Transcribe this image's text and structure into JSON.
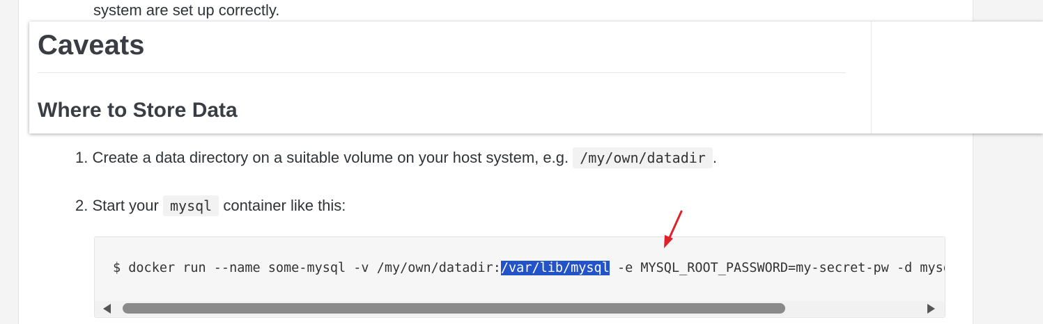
{
  "content": {
    "top_text": "system are set up correctly.",
    "heading_caveats": "Caveats",
    "heading_where": "Where to Store Data",
    "step1": {
      "number": "1.",
      "text_before": "Create a data directory on a suitable volume on your host system, e.g.",
      "code": "/my/own/datadir",
      "text_after": "."
    },
    "step2": {
      "number": "2.",
      "text_before": "Start your",
      "code": "mysql",
      "text_after": "container like this:"
    },
    "code_block": {
      "prefix": "$ docker run --name some-mysql -v /my/own/datadir:",
      "highlighted": "/var/lib/mysql",
      "suffix": " -e MYSQL_ROOT_PASSWORD=my-secret-pw -d mysql:tag"
    }
  },
  "colors": {
    "highlight": "#2353c8",
    "arrow": "#e0202a"
  },
  "icons": {
    "scroll_left": "triangle-left",
    "scroll_right": "triangle-right",
    "annotation": "red-arrow"
  }
}
